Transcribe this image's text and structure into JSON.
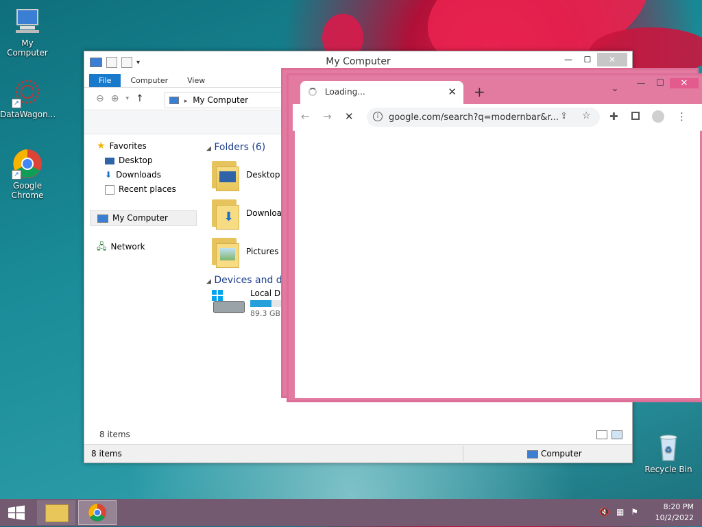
{
  "desktop": {
    "icons": [
      {
        "label": "My Computer"
      },
      {
        "label": "DataWagon..."
      },
      {
        "label": "Google Chrome"
      },
      {
        "label": "Recycle Bin"
      }
    ]
  },
  "explorer": {
    "title": "My Computer",
    "tabs": [
      "File",
      "Computer",
      "View"
    ],
    "address": "My Computer",
    "nav": {
      "favorites": "Favorites",
      "desktop": "Desktop",
      "downloads": "Downloads",
      "recent": "Recent places",
      "my_computer": "My Computer",
      "network": "Network"
    },
    "folders_header": "Folders (6)",
    "folders": [
      "Desktop",
      "Downloa",
      "Pictures"
    ],
    "devices_header": "Devices and dr",
    "disk": {
      "name": "Local Disk",
      "free": "89.3 GB fr",
      "used_fraction": 0.55
    },
    "status_items": "8 items",
    "status_bottom": "8 items",
    "status_computer": "Computer"
  },
  "chrome": {
    "tab_title": "Loading...",
    "url": "google.com/search?q=modernbar&r..."
  },
  "taskbar": {
    "time": "8:20 PM",
    "date": "10/2/2022"
  },
  "colors": {
    "accent": "#1979ca",
    "chrome_frame": "#e37ba1",
    "taskbar": "#735a70"
  }
}
